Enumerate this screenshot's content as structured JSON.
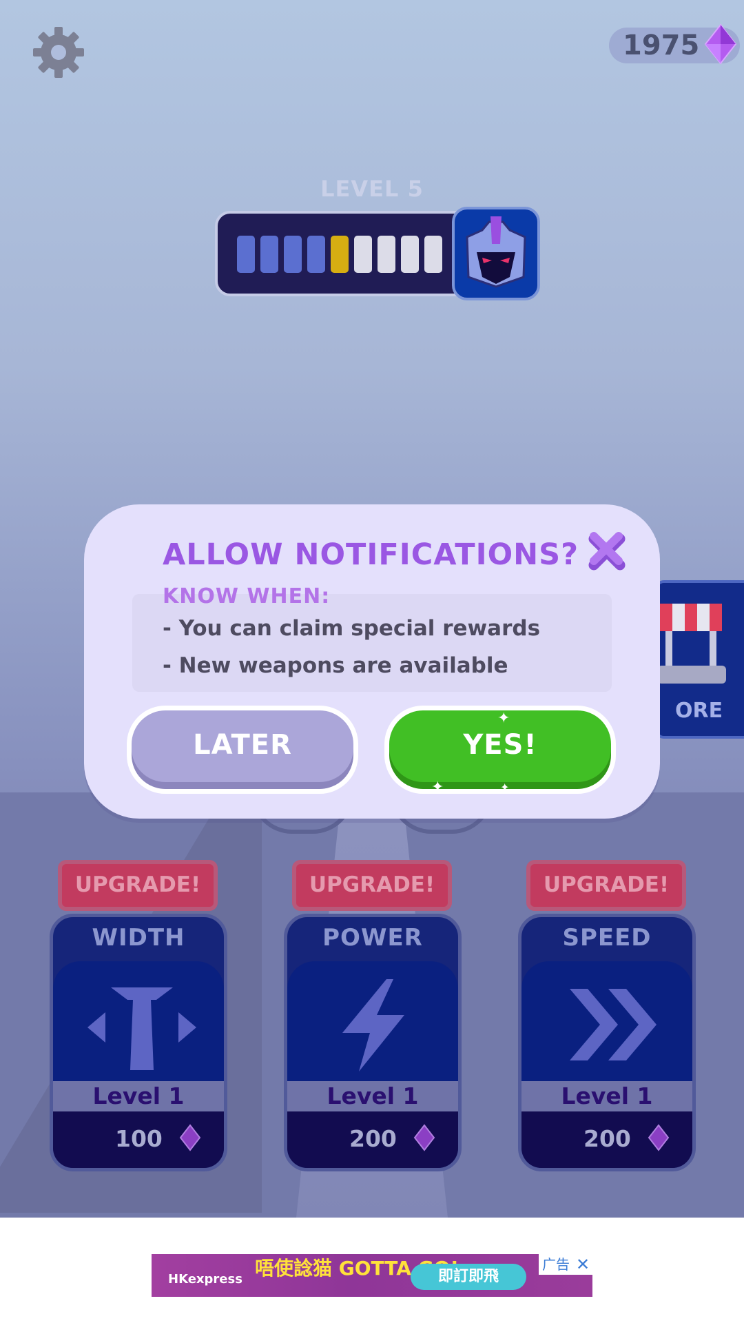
{
  "hud": {
    "gem_count": "1975",
    "level_label": "LEVEL 5",
    "level_progress": {
      "completed_segments": 4,
      "current_segment": 5,
      "total_segments": 9
    }
  },
  "colors": {
    "segment_done": "#5b6fd0",
    "segment_current": "#d6ae12",
    "segment_todo": "#dcdce8",
    "gem": "#a44be0"
  },
  "shop": {
    "label": "ORE"
  },
  "upgrades": [
    {
      "badge": "UPGRADE!",
      "name": "WIDTH",
      "level": "Level 1",
      "price": "100",
      "icon": "width-icon"
    },
    {
      "badge": "UPGRADE!",
      "name": "POWER",
      "level": "Level 1",
      "price": "200",
      "icon": "lightning-icon"
    },
    {
      "badge": "UPGRADE!",
      "name": "SPEED",
      "level": "Level 1",
      "price": "200",
      "icon": "fast-forward-icon"
    }
  ],
  "modal": {
    "title": "ALLOW NOTIFICATIONS?",
    "subtitle": "KNOW WHEN:",
    "lines": [
      "- You can claim special rewards",
      "- New weapons are available"
    ],
    "later_label": "LATER",
    "yes_label": "YES!"
  },
  "ad": {
    "brand": "HKexpress",
    "slogan": "唔使諗猫 GOTTA GO!",
    "cta": "即訂即飛",
    "ad_label": "广告",
    "close": "✕"
  }
}
